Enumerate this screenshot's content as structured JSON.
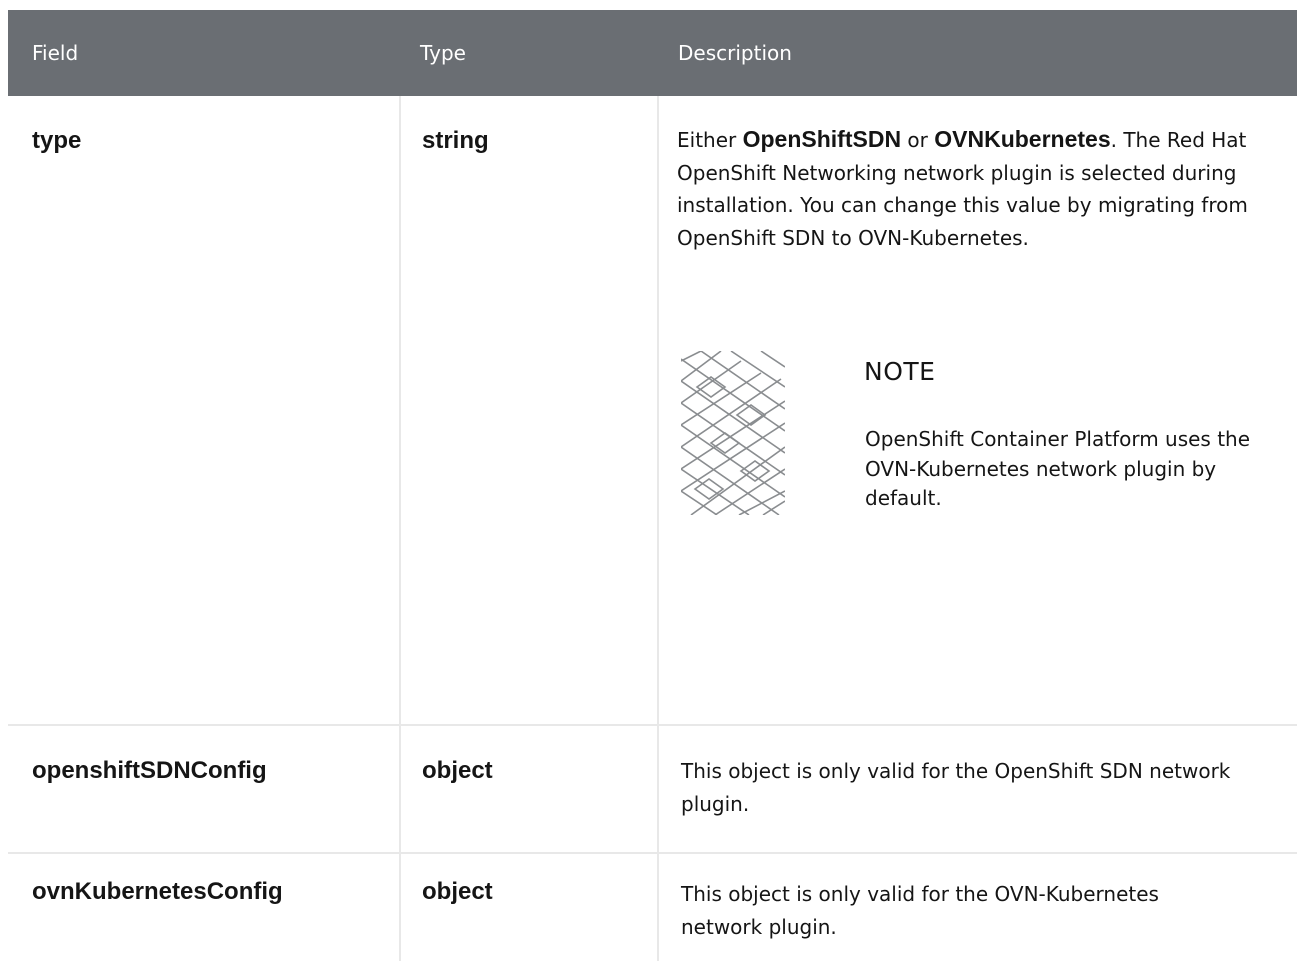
{
  "headers": {
    "field": "Field",
    "type": "Type",
    "description": "Description"
  },
  "rows": [
    {
      "field": "type",
      "type": "string",
      "description": {
        "prefix": "Either ",
        "option1": "OpenShiftSDN",
        "middle": " or ",
        "option2": "OVNKubernetes",
        "suffix": ". The Red Hat OpenShift Networking network plugin is selected during installation. You can change this value by migrating from OpenShift SDN to OVN-Kubernetes."
      },
      "note": {
        "icon": "note-pattern-icon",
        "title": "NOTE",
        "text": "OpenShift Container Platform uses the OVN-Kubernetes network plugin by default."
      }
    },
    {
      "field": "openshiftSDNConfig",
      "type": "object",
      "description": "This object is only valid for the OpenShift SDN network plugin."
    },
    {
      "field": "ovnKubernetesConfig",
      "type": "object",
      "description": "This object is only valid for the OVN-Kubernetes network plugin."
    }
  ],
  "colors": {
    "header_bg": "#6a6e73",
    "header_text": "#ffffff",
    "grid": "#e8e8e8",
    "text": "#151515"
  }
}
